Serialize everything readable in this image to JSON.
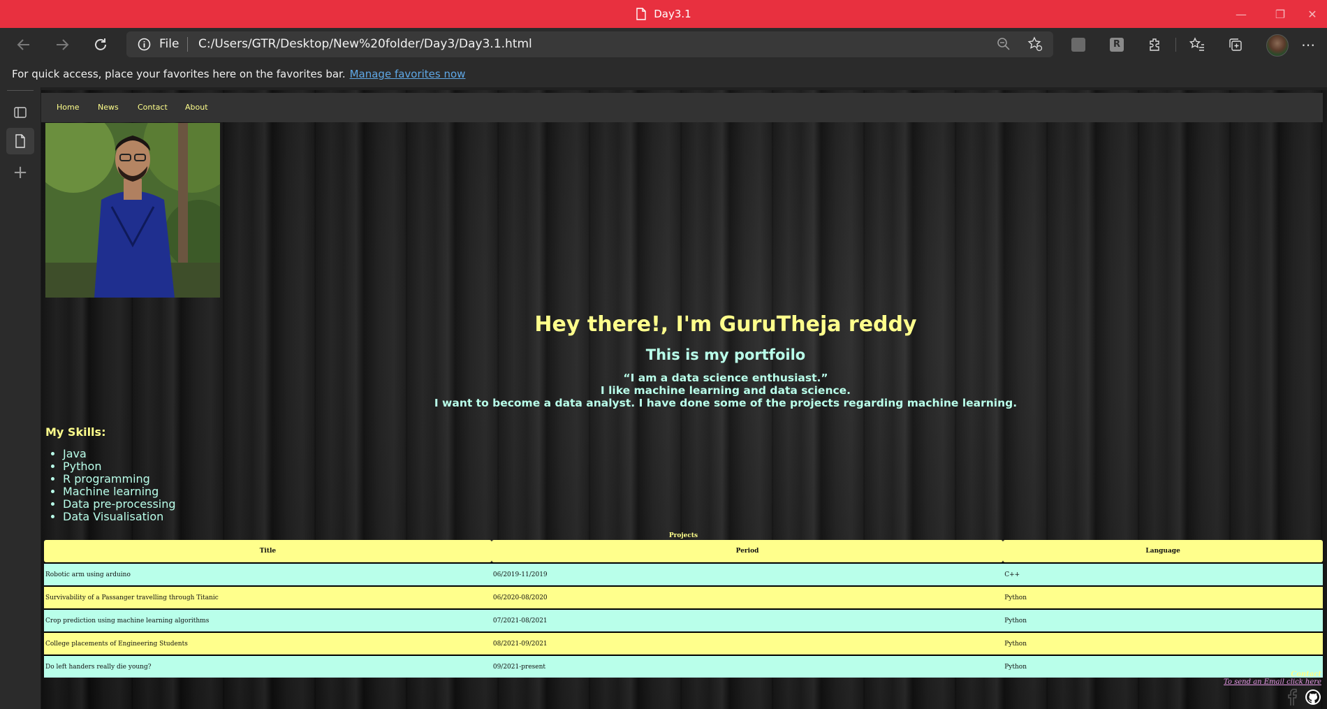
{
  "browser": {
    "tab_title": "Day3.1",
    "address_scheme": "File",
    "url": "C:/Users/GTR/Desktop/New%20folder/Day3/Day3.1.html",
    "favorites_message": "For quick access, place your favorites here on the favorites bar.",
    "favorites_link": "Manage favorites now"
  },
  "site": {
    "nav": [
      "Home",
      "News",
      "Contact",
      "About"
    ],
    "heading": "Hey there!, I'm GuruTheja reddy",
    "subheading": "This is my portfoilo",
    "quote_lines": [
      "“I am a data science enthusiast.”",
      "I like machine learning and data science.",
      "I want to become a data analyst. I have done some of the projects regarding machine learning."
    ],
    "skills_title": "My Skills:",
    "skills": [
      "Java",
      "Python",
      "R programming",
      "Machine learning",
      "Data pre-processing",
      "Data Visualisation"
    ],
    "projects": {
      "caption": "Projects",
      "headers": [
        "Title",
        "Period",
        "Language"
      ],
      "rows": [
        [
          "Robotic arm using arduino",
          "06/2019-11/2019",
          "C++"
        ],
        [
          "Survivability of a Passanger travelling through Titanic",
          "06/2020-08/2020",
          "Python"
        ],
        [
          "Crop prediction using machine learning algorithms",
          "07/2021-08/2021",
          "Python"
        ],
        [
          "College placements of Engineering Students",
          "08/2021-09/2021",
          "Python"
        ],
        [
          "Do left handers really die young?",
          "09/2021-present",
          "Python"
        ]
      ]
    },
    "footer": {
      "contact": "Contact",
      "email_link": "To send an Email click here"
    }
  },
  "colors": {
    "titlebar": "#e8303f",
    "accent_yellow": "#ffff8c",
    "accent_mint": "#b9ffea"
  }
}
